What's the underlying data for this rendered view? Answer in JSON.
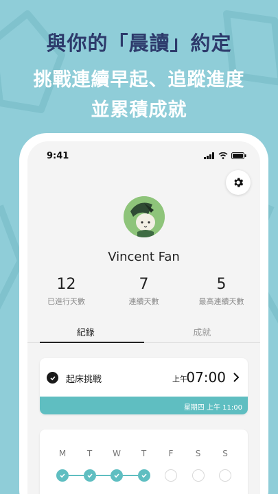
{
  "headline": {
    "line1": "與你的「晨讀」約定",
    "line2": "挑戰連續早起、追蹤進度",
    "line3": "並累積成就"
  },
  "status_bar": {
    "time": "9:41"
  },
  "profile": {
    "name": "Vincent Fan",
    "stats": [
      {
        "value": "12",
        "label": "已進行天數"
      },
      {
        "value": "7",
        "label": "連續天數"
      },
      {
        "value": "5",
        "label": "最高連續天數"
      }
    ]
  },
  "tabs": [
    {
      "label": "紀錄",
      "active": true
    },
    {
      "label": "成就",
      "active": false
    }
  ],
  "challenge": {
    "label": "起床挑戰",
    "period": "上午",
    "time": "07:00",
    "footer": "星期四 上午 11:00"
  },
  "week": {
    "days": [
      "M",
      "T",
      "W",
      "T",
      "F",
      "S",
      "S"
    ],
    "done": [
      true,
      true,
      true,
      true,
      false,
      false,
      false
    ]
  },
  "colors": {
    "background": "#8fcdd8",
    "accent": "#5fbec1",
    "headline_dark": "#2d3a6b"
  }
}
